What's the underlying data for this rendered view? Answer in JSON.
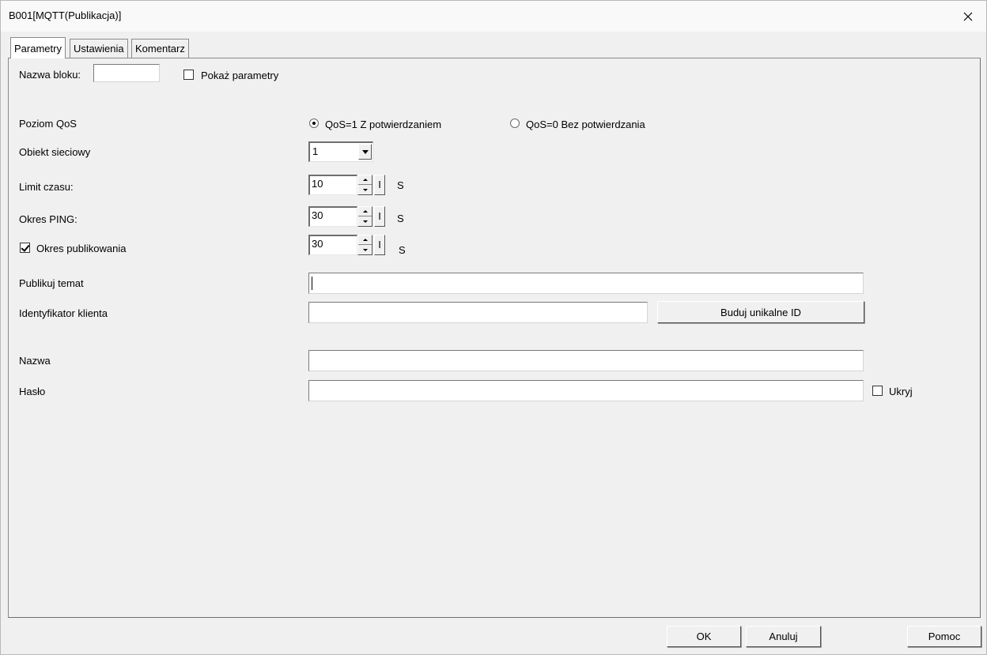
{
  "window": {
    "title": "B001[MQTT(Publikacja)]"
  },
  "tabs": [
    {
      "label": "Parametry"
    },
    {
      "label": "Ustawienia"
    },
    {
      "label": "Komentarz"
    }
  ],
  "form": {
    "block_name_label": "Nazwa bloku:",
    "block_name_value": "",
    "show_params_label": "Pokaż parametry",
    "show_params_checked": false,
    "qos_label": "Poziom QoS",
    "qos_option1": "QoS=1 Z potwierdzaniem",
    "qos_option0": "QoS=0 Bez potwierdzania",
    "qos_selected": "QoS=1 Z potwierdzaniem",
    "network_object_label": "Obiekt sieciowy",
    "network_object_value": "1",
    "timeout_label": "Limit czasu:",
    "timeout_value": "10",
    "timeout_i": "I",
    "timeout_unit": "S",
    "ping_label": "Okres PING:",
    "ping_value": "30",
    "ping_i": "I",
    "ping_unit": "S",
    "publish_period_label": "Okres publikowania",
    "publish_period_checked": true,
    "publish_period_value": "30",
    "publish_period_i": "I",
    "publish_period_unit": "S",
    "publish_topic_label": "Publikuj temat",
    "publish_topic_value": "",
    "client_id_label": "Identyfikator klienta",
    "client_id_value": "",
    "build_id_button": "Buduj unikalne ID",
    "name_label": "Nazwa",
    "name_value": "",
    "password_label": "Hasło",
    "password_value": "",
    "hide_label": "Ukryj",
    "hide_checked": false
  },
  "footer": {
    "ok_label": "OK",
    "cancel_label": "Anuluj",
    "help_label": "Pomoc"
  }
}
